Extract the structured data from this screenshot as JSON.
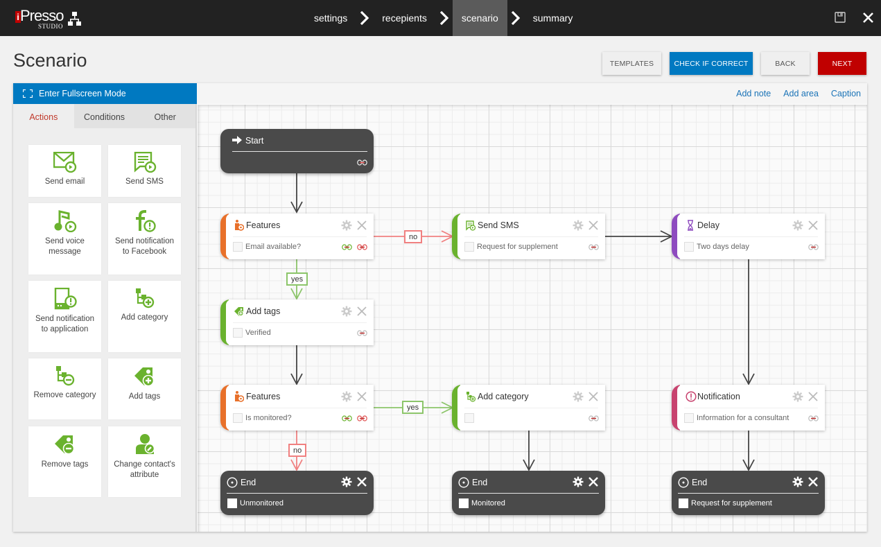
{
  "app": {
    "logo_brand": "Presso",
    "logo_i": "i",
    "logo_sub": "STUDIO"
  },
  "wizard": {
    "steps": [
      {
        "label": "settings",
        "active": false
      },
      {
        "label": "recepients",
        "active": false
      },
      {
        "label": "scenario",
        "active": true
      },
      {
        "label": "summary",
        "active": false
      }
    ]
  },
  "window_icons": [
    "save-icon",
    "close-icon"
  ],
  "page": {
    "title": "Scenario"
  },
  "buttons": {
    "templates": "TEMPLATES",
    "check": "CHECK IF CORRECT",
    "back": "BACK",
    "next": "NEXT"
  },
  "colors": {
    "primary_blue": "#0079c1",
    "next_red": "#c00000",
    "action_green": "#6ab22e",
    "condition_orange": "#e8702a",
    "delay_purple": "#8e4bbf",
    "notification_pink": "#c8436f",
    "yes_edge": "#8cc56a",
    "no_edge": "#f08080"
  },
  "editor": {
    "fullscreen_label": "Enter Fullscreen Mode",
    "toolbar_links": [
      "Add note",
      "Add area",
      "Caption"
    ]
  },
  "palette": {
    "tabs": [
      {
        "label": "Actions",
        "active": true
      },
      {
        "label": "Conditions",
        "active": false
      },
      {
        "label": "Other",
        "active": false
      }
    ],
    "tiles": [
      {
        "label": "Send email",
        "icon": "email-send-icon"
      },
      {
        "label": "Send SMS",
        "icon": "sms-send-icon"
      },
      {
        "label": "Send voice message",
        "icon": "voice-message-icon"
      },
      {
        "label": "Send notification to Facebook",
        "icon": "facebook-notification-icon"
      },
      {
        "label": "Send notification to application",
        "icon": "app-notification-icon"
      },
      {
        "label": "Add category",
        "icon": "add-category-icon"
      },
      {
        "label": "Remove category",
        "icon": "remove-category-icon"
      },
      {
        "label": "Add tags",
        "icon": "add-tag-icon"
      },
      {
        "label": "Remove tags",
        "icon": "remove-tag-icon"
      },
      {
        "label": "Change contact's attribute",
        "icon": "edit-contact-icon"
      }
    ]
  },
  "scenario": {
    "start": {
      "title": "Start"
    },
    "nodes": [
      {
        "id": "features1",
        "type": "condition",
        "title": "Features",
        "subtitle": "Email available?"
      },
      {
        "id": "sms",
        "type": "action",
        "title": "Send SMS",
        "subtitle": "Request for supplement"
      },
      {
        "id": "delay",
        "type": "delay",
        "title": "Delay",
        "subtitle": "Two days delay"
      },
      {
        "id": "addtags",
        "type": "action",
        "title": "Add tags",
        "subtitle": "Verified"
      },
      {
        "id": "features2",
        "type": "condition",
        "title": "Features",
        "subtitle": "Is monitored?"
      },
      {
        "id": "addcat",
        "type": "action",
        "title": "Add category",
        "subtitle": ""
      },
      {
        "id": "notification",
        "type": "notification",
        "title": "Notification",
        "subtitle": "Information for a consultant"
      }
    ],
    "ends": [
      {
        "title": "End",
        "subtitle": "Unmonitored"
      },
      {
        "title": "End",
        "subtitle": "Monitored"
      },
      {
        "title": "End",
        "subtitle": "Request for supplement"
      }
    ],
    "edge_labels": {
      "features1_no": "no",
      "features1_yes": "yes",
      "features2_yes": "yes",
      "features2_no": "no"
    }
  }
}
